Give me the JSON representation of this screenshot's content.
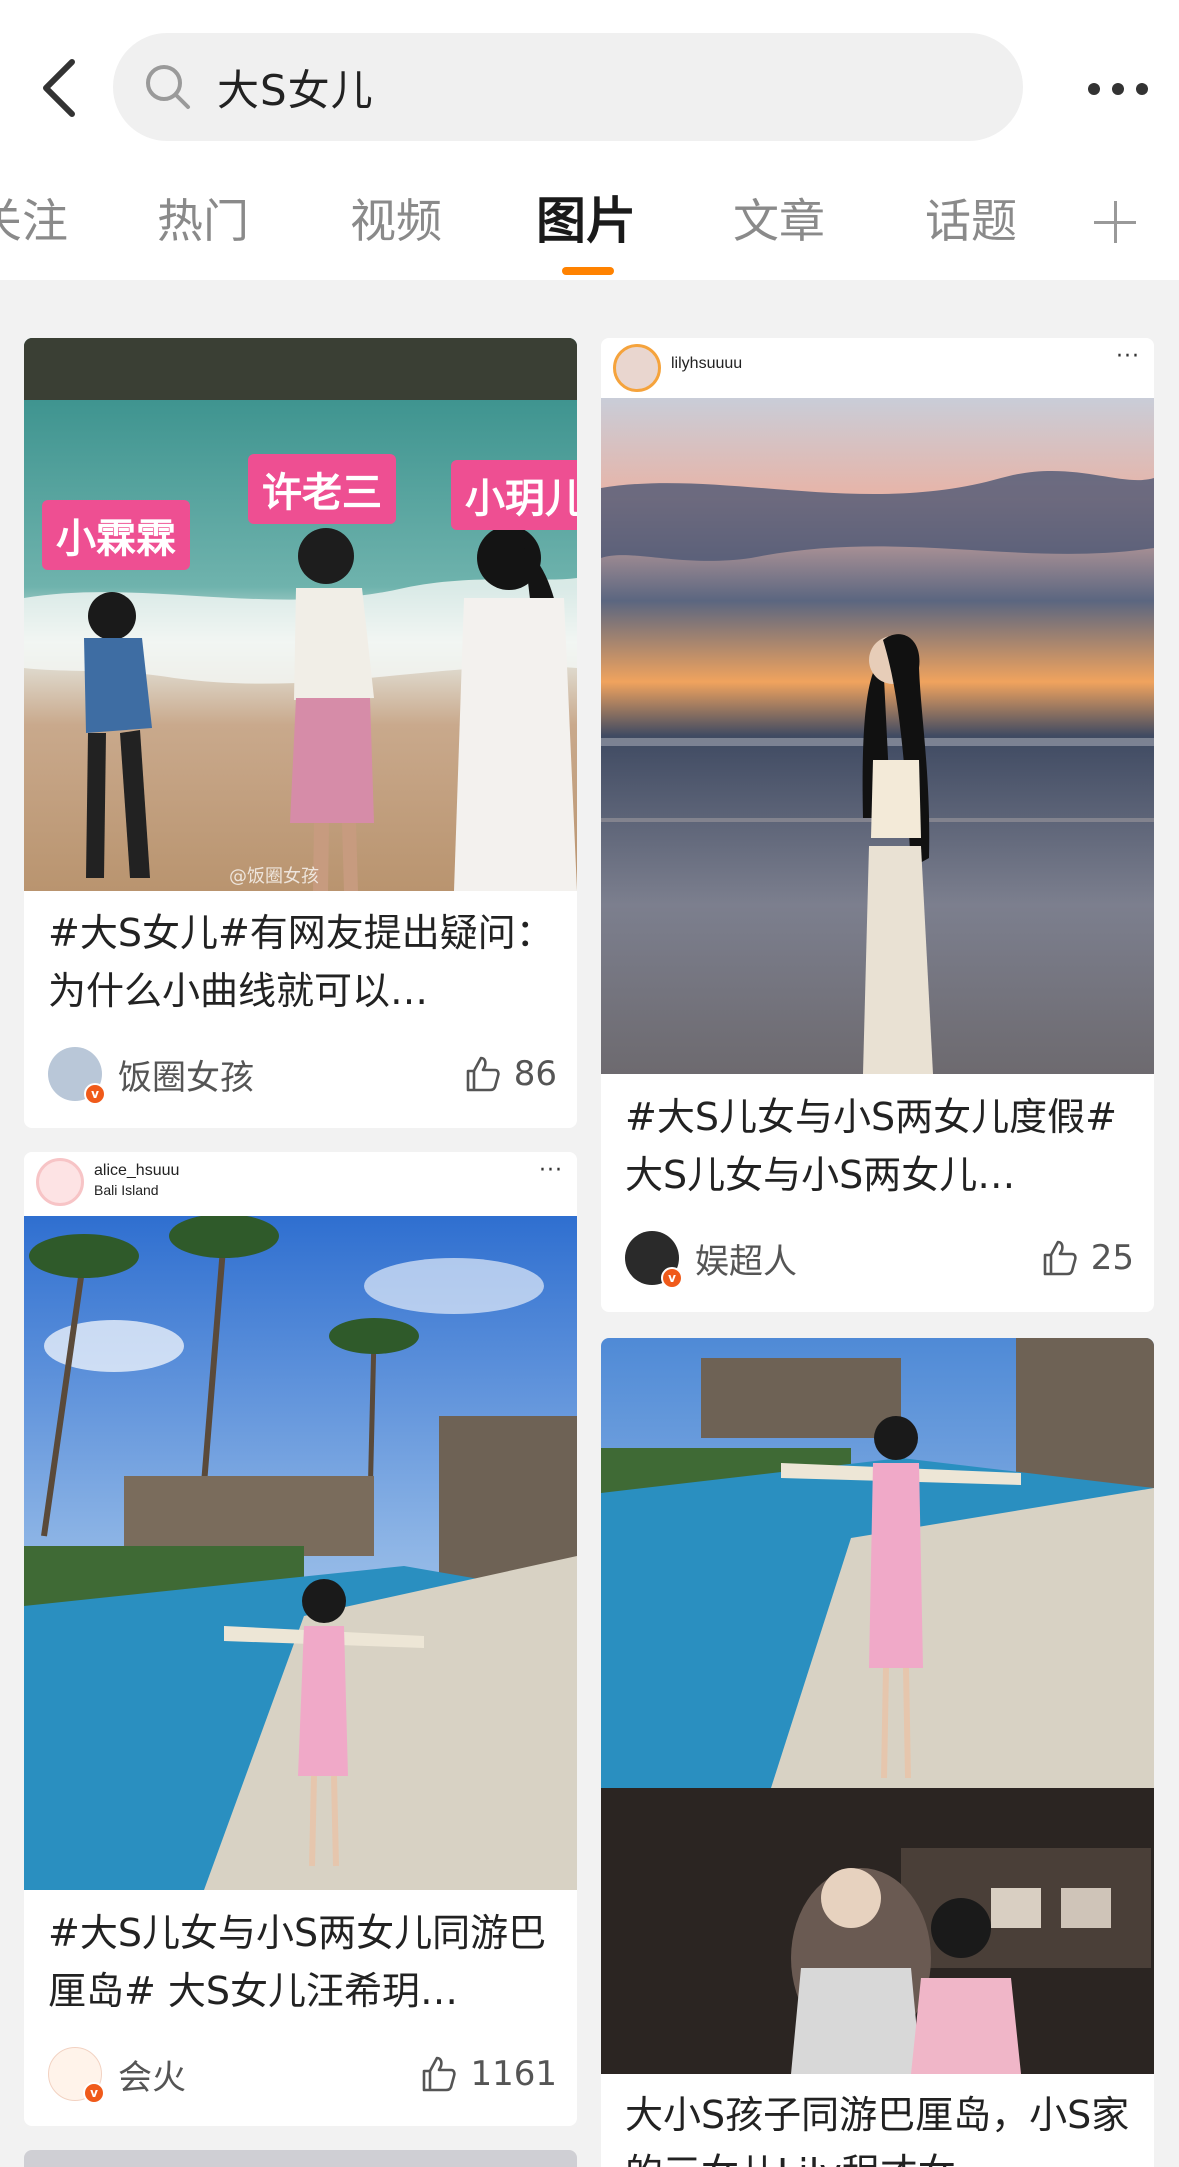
{
  "header": {
    "search_query": "大S女儿",
    "tabs": [
      {
        "label": "关注"
      },
      {
        "label": "热门"
      },
      {
        "label": "视频"
      },
      {
        "label": "图片"
      },
      {
        "label": "文章"
      },
      {
        "label": "话题"
      }
    ],
    "active_tab": "图片"
  },
  "cards": [
    {
      "title": "#大S女儿#有网友提出疑问：为什么小曲线就可以…",
      "author": "饭圈女孩",
      "likes": "86",
      "overlay_labels": [
        "小霖霖",
        "许老三",
        "小玥儿"
      ],
      "watermark": "@饭圈女孩"
    },
    {
      "title": "#大S儿女与小S两女儿度假# 大S儿女与小S两女儿…",
      "author": "娱超人",
      "likes": "25",
      "ig_name": "lilyhsuuuu"
    },
    {
      "title": "#大S儿女与小S两女儿同游巴厘岛# 大S女儿汪希玥…",
      "author": "会火",
      "likes": "1161",
      "ig_name": "alice_hsuuu",
      "ig_location": "Bali Island"
    },
    {
      "title": "大小S孩子同游巴厘岛，小S家的三女儿Lily程才女…"
    }
  ],
  "colors": {
    "accent": "#ff8200",
    "verified_badge": "#f05a1a",
    "label_pink": "#ee4f92"
  }
}
